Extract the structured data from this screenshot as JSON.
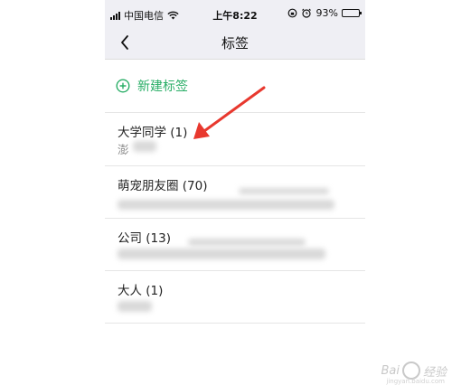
{
  "status_bar": {
    "carrier": "中国电信",
    "time": "上午8:22",
    "battery": "93%",
    "battery_level": 0.93
  },
  "nav": {
    "title": "标签",
    "back_icon": "chevron-left-icon"
  },
  "new_tag": {
    "label": "新建标签",
    "icon": "plus-circle-icon"
  },
  "tags": [
    {
      "name": "大学同学 (1)",
      "members": "澎"
    },
    {
      "name": "萌宠朋友圈 (70)",
      "members": ""
    },
    {
      "name": "公司 (13)",
      "members": ""
    },
    {
      "name": "大人 (1)",
      "members": ""
    }
  ],
  "colors": {
    "accent": "#2aae67",
    "annotation_arrow": "#e8382e",
    "nav_background": "#efeff4"
  },
  "watermark": {
    "brand": "Bai",
    "suffix": "经验",
    "sub": "jingyan.baidu.com"
  }
}
